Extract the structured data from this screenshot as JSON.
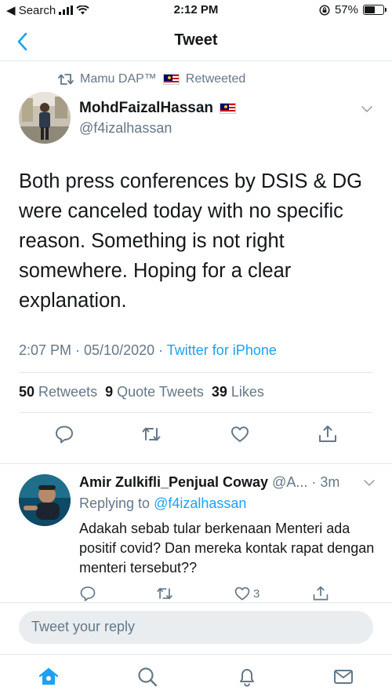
{
  "status_bar": {
    "back_app": "◀ Search",
    "time": "2:12 PM",
    "battery_percent": "57%",
    "battery_level": 0.57
  },
  "nav": {
    "title": "Tweet"
  },
  "retweet": {
    "label": "Mamu DAP™",
    "suffix": "Retweeted"
  },
  "tweet": {
    "author_name": "MohdFaizalHassan",
    "author_handle": "@f4izalhassan",
    "text": "Both press conferences by DSIS & DG were canceled today with no specific reason. Something is not right somewhere. Hoping for a clear explanation.",
    "timestamp": "2:07 PM · 05/10/2020 · ",
    "source": "Twitter for iPhone",
    "stats": {
      "retweets_count": "50",
      "retweets_label": "Retweets",
      "quotes_count": "9",
      "quotes_label": "Quote Tweets",
      "likes_count": "39",
      "likes_label": "Likes"
    }
  },
  "reply": {
    "author_name": "Amir Zulkifli_Penjual Coway",
    "author_handle": "@A...",
    "time": "· 3m",
    "replying_prefix": "Replying to",
    "replying_to": "@f4izalhassan",
    "text": "Adakah sebab tular berkenaan Menteri ada positif covid? Dan mereka kontak rapat dengan menteri tersebut??",
    "like_count": "3"
  },
  "compose": {
    "placeholder": "Tweet your reply"
  },
  "colors": {
    "accent": "#1da1f2",
    "secondary_text": "#657786",
    "divider": "#e1e8ed"
  }
}
